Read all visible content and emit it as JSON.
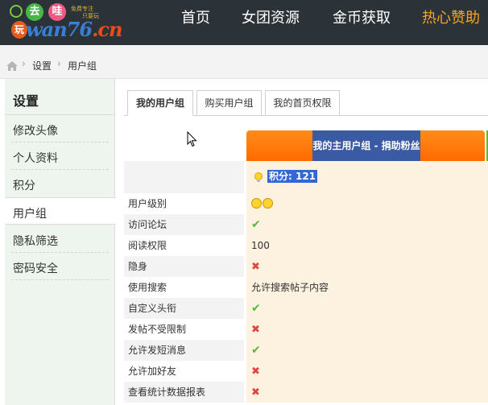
{
  "logo": {
    "play": "玩",
    "qu": "去",
    "wa": "哇",
    "slogan_1": "免费专注",
    "slogan_2": "只要玩",
    "wordmark": "wan76",
    "tld": ".cn"
  },
  "nav": [
    "首页",
    "女团资源",
    "金币获取",
    "热心赞助"
  ],
  "breadcrumb": [
    "设置",
    "用户组"
  ],
  "sidebar": {
    "title": "设置",
    "items": [
      "修改头像",
      "个人资料",
      "积分",
      "用户组",
      "隐私筛选",
      "密码安全"
    ],
    "active_index": 3
  },
  "tabs": [
    "我的用户组",
    "购买用户组",
    "我的首页权限"
  ],
  "group_header": "我的主用户组 - 捐助粉丝",
  "credits_text": "积分: 121",
  "rows": [
    {
      "label": "用户级别",
      "value": "",
      "type": "smiley"
    },
    {
      "label": "访问论坛",
      "value": "✔",
      "type": "check"
    },
    {
      "label": "阅读权限",
      "value": "100",
      "type": "text"
    },
    {
      "label": "隐身",
      "value": "✖",
      "type": "cross"
    },
    {
      "label": "使用搜索",
      "value": "允许搜索帖子内容",
      "type": "text"
    },
    {
      "label": "自定义头衔",
      "value": "✔",
      "type": "check"
    },
    {
      "label": "发帖不受限制",
      "value": "✖",
      "type": "cross"
    },
    {
      "label": "允许发短消息",
      "value": "✔",
      "type": "check"
    },
    {
      "label": "允许加好友",
      "value": "✖",
      "type": "cross"
    },
    {
      "label": "查看统计数据报表",
      "value": "✖",
      "type": "cross"
    }
  ],
  "colors": {
    "topbar": "#2b3339",
    "accent_orange": "#ff7a00",
    "header_blue": "#3b5aa4",
    "check_green": "#55b83a",
    "cross_red": "#e0443a"
  }
}
